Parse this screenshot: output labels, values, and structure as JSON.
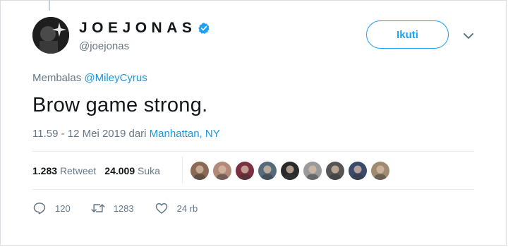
{
  "profile": {
    "display_name": "JOEJONAS",
    "handle": "@joejonas",
    "verified": true
  },
  "follow_button": {
    "label": "Ikuti"
  },
  "reply_to": {
    "prefix": "Membalas",
    "mention": "@MileyCyrus"
  },
  "tweet": {
    "text": "Brow game strong."
  },
  "meta": {
    "time_date": "11.59 - 12 Mei 2019 dari",
    "location": "Manhattan, NY"
  },
  "stats": {
    "retweets_count": "1.283",
    "retweets_label": "Retweet",
    "likes_count": "24.009",
    "likes_label": "Suka"
  },
  "liker_avatars": [
    {
      "color": "#8a6a55"
    },
    {
      "color": "#b3897a"
    },
    {
      "color": "#7a3040"
    },
    {
      "color": "#556b7a"
    },
    {
      "color": "#2a2a2a"
    },
    {
      "color": "#9a9a9a"
    },
    {
      "color": "#555555"
    },
    {
      "color": "#3a4a6a"
    },
    {
      "color": "#a08a70"
    }
  ],
  "actions": {
    "reply_count": "120",
    "retweet_count": "1283",
    "like_count": "24 rb"
  },
  "colors": {
    "accent": "#1da1f2",
    "link": "#1b95e0",
    "secondary_text": "#657786"
  },
  "icons": [
    "verified-badge-icon",
    "chevron-down-icon",
    "reply-icon",
    "retweet-icon",
    "like-icon"
  ]
}
